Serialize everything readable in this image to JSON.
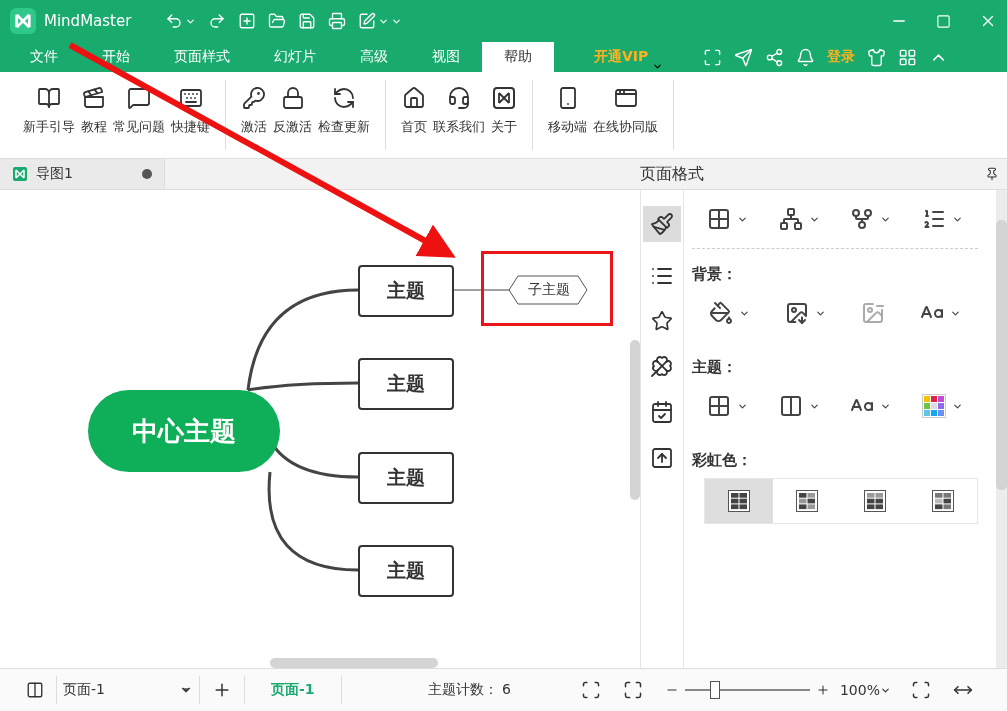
{
  "app": {
    "name": "MindMaster"
  },
  "menu_tabs": [
    {
      "label": "文件",
      "selected": false
    },
    {
      "label": "开始",
      "selected": false
    },
    {
      "label": "页面样式",
      "selected": false
    },
    {
      "label": "幻灯片",
      "selected": false
    },
    {
      "label": "高级",
      "selected": false
    },
    {
      "label": "视图",
      "selected": false
    },
    {
      "label": "帮助",
      "selected": true
    }
  ],
  "vip": "开通VIP",
  "login": "登录",
  "ribbon_groups": [
    [
      {
        "label": "新手引导"
      },
      {
        "label": "教程"
      },
      {
        "label": "常见问题"
      },
      {
        "label": "快捷键"
      }
    ],
    [
      {
        "label": "激活"
      },
      {
        "label": "反激活"
      },
      {
        "label": "检查更新"
      }
    ],
    [
      {
        "label": "首页"
      },
      {
        "label": "联系我们"
      },
      {
        "label": "关于"
      }
    ],
    [
      {
        "label": "移动端"
      },
      {
        "label": "在线协同版"
      }
    ]
  ],
  "doc_tab": {
    "title": "导图1",
    "unsaved": true
  },
  "mind_map": {
    "central": "中心主题",
    "topics": [
      {
        "label": "主题",
        "children": [
          {
            "label": "子主题",
            "highlighted": true
          }
        ]
      },
      {
        "label": "主题"
      },
      {
        "label": "主题"
      },
      {
        "label": "主题"
      }
    ]
  },
  "panel": {
    "title": "页面格式",
    "sections": [
      {
        "label": "背景："
      },
      {
        "label": "主题："
      },
      {
        "label": "彩虹色："
      }
    ],
    "rainbow_options": [
      {
        "selected": true
      },
      {
        "selected": false
      },
      {
        "selected": false
      },
      {
        "selected": false
      }
    ]
  },
  "status_bar": {
    "page_select": "页面-1",
    "page_tab": "页面-1",
    "topic_count": "主题计数： 6",
    "zoom": "100%",
    "zoom_slider": {
      "level": 0.23
    }
  }
}
